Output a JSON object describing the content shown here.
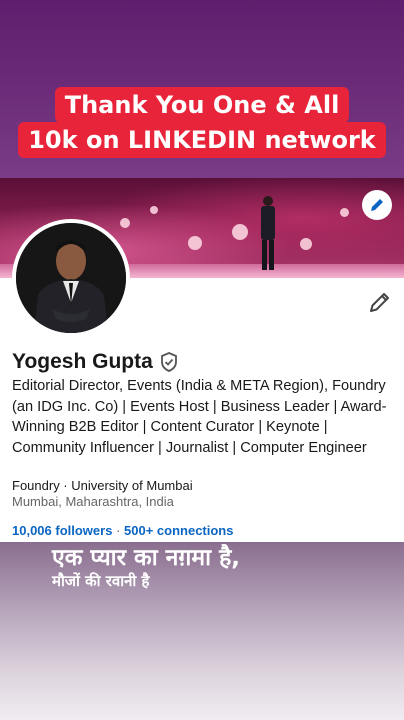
{
  "overlay": {
    "line1": "Thank You One & All",
    "line2": "10k on LINKEDIN network",
    "accent": "#e8243a"
  },
  "profile": {
    "name": "Yogesh Gupta",
    "headline": "Editorial Director, Events (India & META Region), Foundry (an IDG Inc. Co) | Events Host | Business Leader | Award-Winning B2B Editor | Content Curator | Keynote | Community Influencer | Journalist | Computer Engineer",
    "company": "Foundry · University of Mumbai",
    "location": "Mumbai, Maharashtra, India",
    "followers": "10,006 followers",
    "separator": " · ",
    "connections": "500+ connections",
    "link_color": "#0a66c2"
  },
  "icons": {
    "cover_edit": "pencil-icon",
    "profile_edit": "pencil-icon",
    "verified": "verified-shield-icon"
  },
  "lyrics": {
    "line1": "एक प्यार का नग़मा है,",
    "line2": "मौजों की रवानी है"
  }
}
